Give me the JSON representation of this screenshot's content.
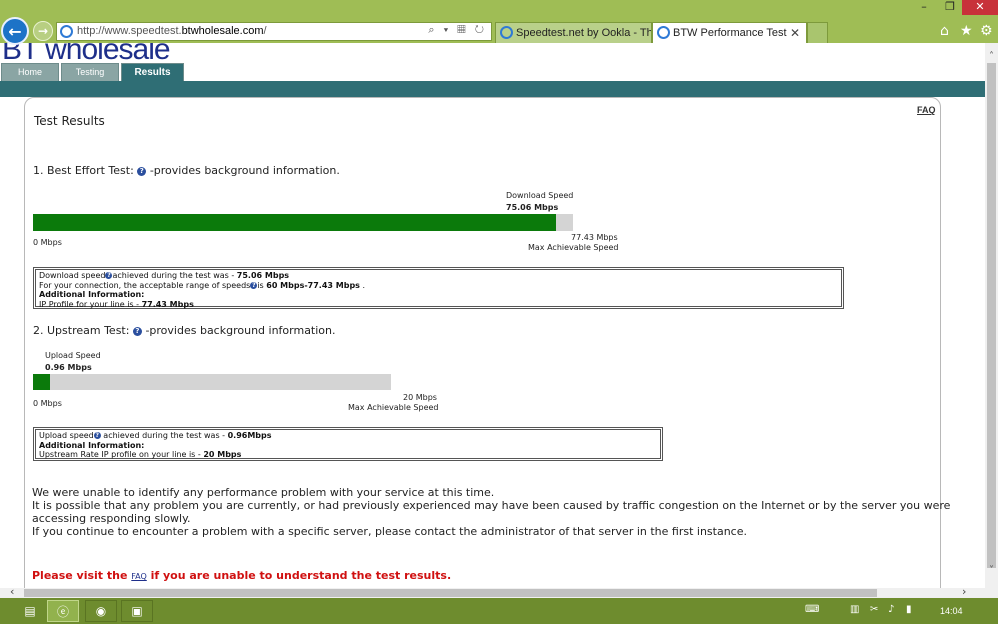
{
  "browser": {
    "url_prefix": "http://www.speedtest.",
    "url_domain": "btwholesale.com",
    "url_suffix": "/",
    "address_tools": "⌕ ▾ ▦ ↻",
    "tabs": [
      {
        "title": "Speedtest.net by Ookla - The G...",
        "active": false
      },
      {
        "title": "BTW Performance Test",
        "active": true
      }
    ]
  },
  "site": {
    "logo": "BT wholesale",
    "nav_tabs": [
      "Home",
      "Testing",
      "Results"
    ],
    "active_tab": "Results",
    "faq_link": "FAQ",
    "page_title": "Test Results"
  },
  "download_test": {
    "heading_prefix": "1. Best Effort Test:",
    "heading_suffix": "-provides background information.",
    "speed_label": "Download Speed",
    "speed_value": "75.06 Mbps",
    "speed_fraction": 0.9694,
    "min_label": "0 Mbps",
    "max_value": "77.43 Mbps",
    "max_label": "Max Achievable Speed",
    "info": {
      "line1_prefix": "Download speed",
      "line1_middle": "achieved during the test was - ",
      "line1_value": "75.06 Mbps",
      "line2_prefix": "For your connection, the acceptable range of speeds",
      "line2_middle": "is ",
      "line2_value": "60 Mbps-77.43 Mbps",
      "line2_suffix": " .",
      "line3": "Additional Information:",
      "line4_prefix": "IP Profile for your line is - ",
      "line4_value": "77.43 Mbps"
    }
  },
  "upload_test": {
    "heading_prefix": "2. Upstream Test:",
    "heading_suffix": "-provides background information.",
    "speed_label": "Upload Speed",
    "speed_value": "0.96 Mbps",
    "speed_fraction": 0.048,
    "min_label": "0 Mbps",
    "max_value": "20 Mbps",
    "max_label": "Max Achievable Speed",
    "info": {
      "line1_prefix": "Upload speed",
      "line1_middle": " achieved during the test was - ",
      "line1_value": "0.96Mbps",
      "line2": "Additional Information:",
      "line3_prefix": "Upstream Rate IP profile on your line is - ",
      "line3_value": "20 Mbps"
    }
  },
  "summary": {
    "lines": [
      "We were unable to identify any performance problem with your service at this time.",
      "It is possible that any problem you are currently, or had previously experienced may have been caused by traffic congestion on the Internet or by the server you were",
      "accessing responding slowly.",
      "If you continue to encounter a problem with a specific server, please contact the administrator of that server in the first instance."
    ],
    "please_prefix": "Please visit the ",
    "please_link": "FAQ",
    "please_suffix": " if you are unable to understand the test results."
  },
  "taskbar": {
    "clock": "14:04"
  },
  "colors": {
    "bar_fill": "#0b7a0b",
    "bar_track": "#d4d4d4",
    "teal": "#2f6e75",
    "warning_text": "#d01010"
  }
}
